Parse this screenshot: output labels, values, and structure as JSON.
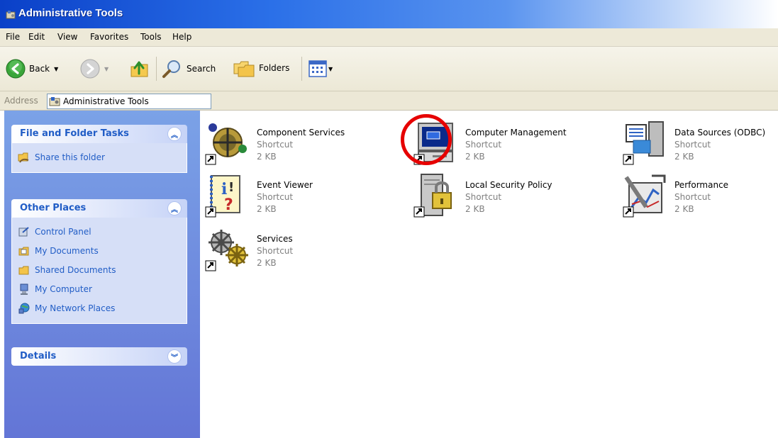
{
  "window": {
    "title": "Administrative Tools"
  },
  "menubar": {
    "items": [
      "File",
      "Edit",
      "View",
      "Favorites",
      "Tools",
      "Help"
    ]
  },
  "toolbar": {
    "back_label": "Back",
    "search_label": "Search",
    "folders_label": "Folders",
    "icons": [
      "back-arrow-icon",
      "forward-arrow-icon",
      "up-folder-icon",
      "search-magnifier-icon",
      "folders-icon",
      "views-icon"
    ]
  },
  "address": {
    "label": "Address",
    "value": "Administrative Tools"
  },
  "sidebar": {
    "file_tasks": {
      "title": "File and Folder Tasks",
      "items": [
        {
          "label": "Share this folder",
          "icon": "share-folder-icon"
        }
      ]
    },
    "other_places": {
      "title": "Other Places",
      "items": [
        {
          "label": "Control Panel",
          "icon": "control-panel-icon"
        },
        {
          "label": "My Documents",
          "icon": "my-documents-icon"
        },
        {
          "label": "Shared Documents",
          "icon": "shared-documents-icon"
        },
        {
          "label": "My Computer",
          "icon": "my-computer-icon"
        },
        {
          "label": "My Network Places",
          "icon": "my-network-places-icon"
        }
      ]
    },
    "details": {
      "title": "Details"
    }
  },
  "items": [
    {
      "name": "Component Services",
      "type": "Shortcut",
      "size": "2 KB",
      "icon": "component-services-icon"
    },
    {
      "name": "Computer Management",
      "type": "Shortcut",
      "size": "2 KB",
      "icon": "computer-management-icon",
      "highlighted": true
    },
    {
      "name": "Data Sources (ODBC)",
      "type": "Shortcut",
      "size": "2 KB",
      "icon": "data-sources-icon"
    },
    {
      "name": "Event Viewer",
      "type": "Shortcut",
      "size": "2 KB",
      "icon": "event-viewer-icon"
    },
    {
      "name": "Local Security Policy",
      "type": "Shortcut",
      "size": "2 KB",
      "icon": "local-security-policy-icon"
    },
    {
      "name": "Performance",
      "type": "Shortcut",
      "size": "2 KB",
      "icon": "performance-icon"
    },
    {
      "name": "Services",
      "type": "Shortcut",
      "size": "2 KB",
      "icon": "services-icon"
    }
  ],
  "colors": {
    "title_bar": "#0a40c8",
    "taskbox_header_text": "#215dc6",
    "sidebar_gradient_top": "#7ba2e7",
    "sidebar_gradient_bottom": "#6375d6",
    "highlight_circle": "#e60000"
  }
}
